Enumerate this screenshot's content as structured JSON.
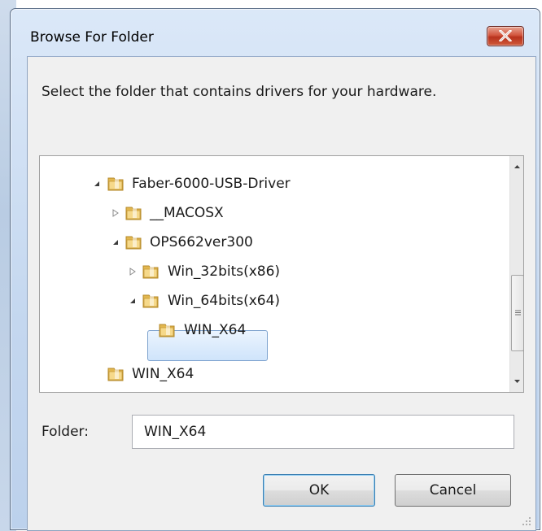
{
  "window": {
    "title": "Browse For Folder",
    "close_icon": "close-icon"
  },
  "dialog": {
    "prompt": "Select the folder that contains drivers for your hardware."
  },
  "tree": {
    "items": [
      {
        "label": "Faber-6000-USB-Driver",
        "level": 0,
        "state": "expanded",
        "icon": "folder-icon"
      },
      {
        "label": "__MACOSX",
        "level": 1,
        "state": "collapsed",
        "icon": "folder-icon"
      },
      {
        "label": "OPS662ver300",
        "level": 1,
        "state": "expanded",
        "icon": "folder-icon"
      },
      {
        "label": "Win_32bits(x86)",
        "level": 2,
        "state": "collapsed",
        "icon": "folder-icon"
      },
      {
        "label": "Win_64bits(x64)",
        "level": 2,
        "state": "expanded",
        "icon": "folder-icon"
      },
      {
        "label": "WIN_X64",
        "level": 3,
        "state": "leaf",
        "selected": true,
        "icon": "folder-icon"
      },
      {
        "label": "WIN_X64",
        "level": 0,
        "state": "leaf",
        "icon": "folder-icon"
      }
    ]
  },
  "folder_field": {
    "label": "Folder:",
    "value": "WIN_X64"
  },
  "buttons": {
    "ok": "OK",
    "cancel": "Cancel"
  },
  "colors": {
    "title_bar": "#c4d7ef",
    "close_button": "#c8452c",
    "selection": "#cfe4fb",
    "default_button_border": "#3c7fb1"
  }
}
